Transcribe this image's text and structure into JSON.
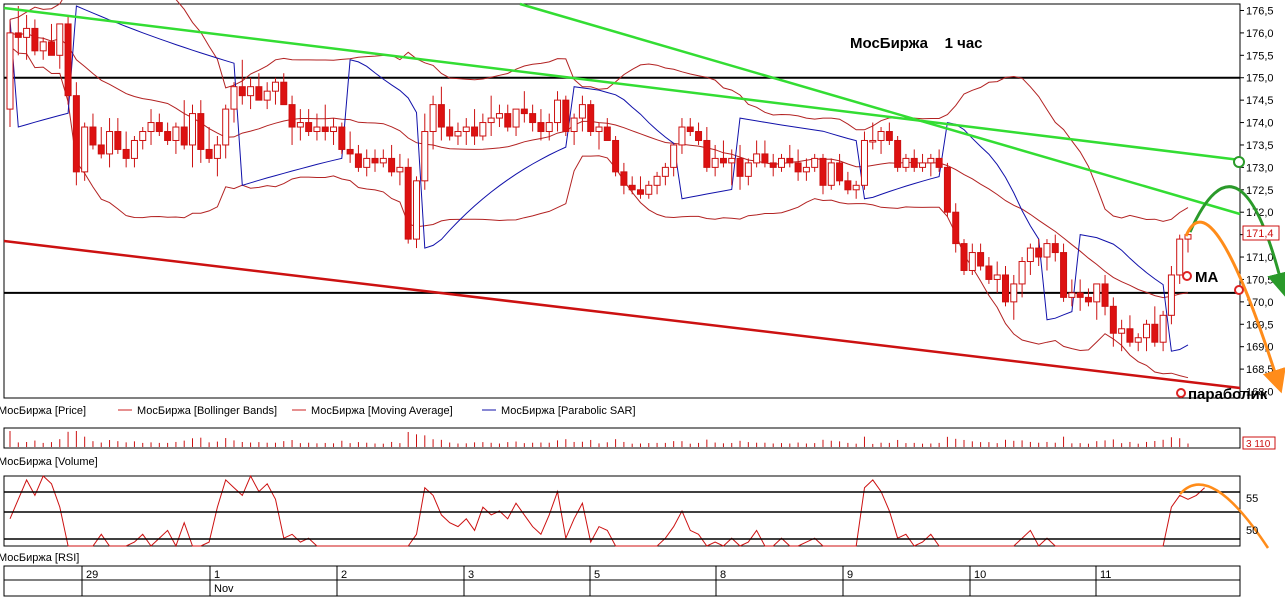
{
  "chart_data": {
    "type": "candlestick",
    "title": "МосБиржа    1 час",
    "price_axis": {
      "ylim": [
        167.9,
        176.6
      ],
      "ticks": [
        "176,5",
        "176,0",
        "175,5",
        "175,0",
        "174,5",
        "174,0",
        "173,5",
        "173,0",
        "172,5",
        "172,0",
        "171,5",
        "171,0",
        "170,5",
        "170,0",
        "169,5",
        "169,0",
        "168,5",
        "168,0"
      ]
    },
    "last_price_label": "171,4",
    "volume_label": "3 110",
    "rsi_axis": {
      "ticks": [
        "55",
        "50"
      ]
    },
    "legend_price": [
      "МосБиржа [Price]",
      "МосБиржа [Bollinger Bands]",
      "МосБиржа [Moving Average]",
      "МосБиржа [Parabolic SAR]"
    ],
    "legend_volume": "МосБиржа [Volume]",
    "legend_rsi": "МосБиржа [RSI]",
    "annotations": {
      "ma": "MA",
      "sar": "параболик"
    },
    "dates": [
      {
        "label": "29",
        "sub": ""
      },
      {
        "label": "1",
        "sub": "Nov"
      },
      {
        "label": "2",
        "sub": ""
      },
      {
        "label": "3",
        "sub": ""
      },
      {
        "label": "5",
        "sub": ""
      },
      {
        "label": "8",
        "sub": ""
      },
      {
        "label": "9",
        "sub": ""
      },
      {
        "label": "10",
        "sub": ""
      },
      {
        "label": "11",
        "sub": ""
      }
    ],
    "horizontal_levels": [
      175.0,
      170.2
    ],
    "candles": [
      [
        174.3,
        176.3,
        173.9,
        176.0
      ],
      [
        176.0,
        176.6,
        175.5,
        175.9
      ],
      [
        175.9,
        176.4,
        175.4,
        176.1
      ],
      [
        176.1,
        176.3,
        175.5,
        175.6
      ],
      [
        175.6,
        175.9,
        175.4,
        175.8
      ],
      [
        175.8,
        176.2,
        175.6,
        175.5
      ],
      [
        175.5,
        176.1,
        175.2,
        176.2
      ],
      [
        176.2,
        176.4,
        174.4,
        174.6
      ],
      [
        174.6,
        174.9,
        172.6,
        172.9
      ],
      [
        172.9,
        174.0,
        172.7,
        173.9
      ],
      [
        173.9,
        174.2,
        173.4,
        173.5
      ],
      [
        173.5,
        173.9,
        173.2,
        173.3
      ],
      [
        173.3,
        174.1,
        173.0,
        173.8
      ],
      [
        173.8,
        174.1,
        173.3,
        173.4
      ],
      [
        173.4,
        173.8,
        173.0,
        173.2
      ],
      [
        173.2,
        173.7,
        173.0,
        173.6
      ],
      [
        173.6,
        173.9,
        173.4,
        173.8
      ],
      [
        173.8,
        174.3,
        173.5,
        174.0
      ],
      [
        174.0,
        174.2,
        173.7,
        173.8
      ],
      [
        173.8,
        174.0,
        173.5,
        173.6
      ],
      [
        173.6,
        174.0,
        173.3,
        173.9
      ],
      [
        173.9,
        174.5,
        173.4,
        173.5
      ],
      [
        173.5,
        174.4,
        173.0,
        174.2
      ],
      [
        174.2,
        174.5,
        173.1,
        173.4
      ],
      [
        173.4,
        173.9,
        173.1,
        173.2
      ],
      [
        173.2,
        173.7,
        172.8,
        173.5
      ],
      [
        173.5,
        174.4,
        173.2,
        174.3
      ],
      [
        174.3,
        174.9,
        174.0,
        174.8
      ],
      [
        174.8,
        175.4,
        174.4,
        174.6
      ],
      [
        174.6,
        175.0,
        174.3,
        174.8
      ],
      [
        174.8,
        175.1,
        174.5,
        174.5
      ],
      [
        174.5,
        174.9,
        174.3,
        174.7
      ],
      [
        174.7,
        175.0,
        174.4,
        174.9
      ],
      [
        174.9,
        175.1,
        174.6,
        174.4
      ],
      [
        174.4,
        174.6,
        173.5,
        173.9
      ],
      [
        173.9,
        174.3,
        173.6,
        174.0
      ],
      [
        174.0,
        174.3,
        173.7,
        173.8
      ],
      [
        173.8,
        174.2,
        173.6,
        173.9
      ],
      [
        173.9,
        174.4,
        173.6,
        173.8
      ],
      [
        173.8,
        174.1,
        173.5,
        173.9
      ],
      [
        173.9,
        174.0,
        173.3,
        173.4
      ],
      [
        173.4,
        173.8,
        173.1,
        173.3
      ],
      [
        173.3,
        173.5,
        172.9,
        173.0
      ],
      [
        173.0,
        173.4,
        172.8,
        173.2
      ],
      [
        173.2,
        173.4,
        172.9,
        173.1
      ],
      [
        173.1,
        173.4,
        173.0,
        173.2
      ],
      [
        173.2,
        173.5,
        172.8,
        172.9
      ],
      [
        172.9,
        173.3,
        172.6,
        173.0
      ],
      [
        173.0,
        173.2,
        171.3,
        171.4
      ],
      [
        171.4,
        172.8,
        171.2,
        172.7
      ],
      [
        172.7,
        174.2,
        172.5,
        173.8
      ],
      [
        173.8,
        174.6,
        173.4,
        174.4
      ],
      [
        174.4,
        174.8,
        173.6,
        173.9
      ],
      [
        173.9,
        174.3,
        173.6,
        173.7
      ],
      [
        173.7,
        174.0,
        173.5,
        173.8
      ],
      [
        173.8,
        174.1,
        173.5,
        173.9
      ],
      [
        173.9,
        174.3,
        173.5,
        173.7
      ],
      [
        173.7,
        174.2,
        173.6,
        174.0
      ],
      [
        174.0,
        174.6,
        173.7,
        174.1
      ],
      [
        174.1,
        174.4,
        173.9,
        174.2
      ],
      [
        174.2,
        174.4,
        173.8,
        173.9
      ],
      [
        173.9,
        174.3,
        173.7,
        174.3
      ],
      [
        174.3,
        174.7,
        174.0,
        174.2
      ],
      [
        174.2,
        174.4,
        173.8,
        174.0
      ],
      [
        174.0,
        174.3,
        173.6,
        173.8
      ],
      [
        173.8,
        174.2,
        173.6,
        174.0
      ],
      [
        174.0,
        174.7,
        173.8,
        174.5
      ],
      [
        174.5,
        174.6,
        173.7,
        173.8
      ],
      [
        173.8,
        174.2,
        173.5,
        174.1
      ],
      [
        174.1,
        174.6,
        173.8,
        174.4
      ],
      [
        174.4,
        174.5,
        173.7,
        173.8
      ],
      [
        173.8,
        174.0,
        173.4,
        173.9
      ],
      [
        173.9,
        174.1,
        173.6,
        173.6
      ],
      [
        173.6,
        173.7,
        172.8,
        172.9
      ],
      [
        172.9,
        173.1,
        172.4,
        172.6
      ],
      [
        172.6,
        172.8,
        172.4,
        172.5
      ],
      [
        172.5,
        172.8,
        172.3,
        172.4
      ],
      [
        172.4,
        172.7,
        172.3,
        172.6
      ],
      [
        172.6,
        172.9,
        172.4,
        172.8
      ],
      [
        172.8,
        173.1,
        172.6,
        173.0
      ],
      [
        173.0,
        173.3,
        172.8,
        173.5
      ],
      [
        173.5,
        174.1,
        173.3,
        173.9
      ],
      [
        173.9,
        174.1,
        173.7,
        173.8
      ],
      [
        173.8,
        174.0,
        173.5,
        173.6
      ],
      [
        173.6,
        173.9,
        172.9,
        173.0
      ],
      [
        173.0,
        173.5,
        172.8,
        173.2
      ],
      [
        173.2,
        173.6,
        173.0,
        173.1
      ],
      [
        173.1,
        173.4,
        172.6,
        173.2
      ],
      [
        173.2,
        173.5,
        172.5,
        172.8
      ],
      [
        172.8,
        173.2,
        172.6,
        173.1
      ],
      [
        173.1,
        173.6,
        173.0,
        173.3
      ],
      [
        173.3,
        173.6,
        173.0,
        173.1
      ],
      [
        173.1,
        173.3,
        172.8,
        173.0
      ],
      [
        173.0,
        173.3,
        172.9,
        173.2
      ],
      [
        173.2,
        173.5,
        173.0,
        173.1
      ],
      [
        173.1,
        173.4,
        172.7,
        172.9
      ],
      [
        172.9,
        173.2,
        172.7,
        173.0
      ],
      [
        173.0,
        173.3,
        172.9,
        173.2
      ],
      [
        173.2,
        173.3,
        172.4,
        172.6
      ],
      [
        172.6,
        173.2,
        172.5,
        173.1
      ],
      [
        173.1,
        173.3,
        172.6,
        172.7
      ],
      [
        172.7,
        172.9,
        172.4,
        172.5
      ],
      [
        172.5,
        172.7,
        172.3,
        172.6
      ],
      [
        172.6,
        173.8,
        172.5,
        173.6
      ],
      [
        173.6,
        174.0,
        173.4,
        173.6
      ],
      [
        173.6,
        173.9,
        173.3,
        173.8
      ],
      [
        173.8,
        174.0,
        173.5,
        173.6
      ],
      [
        173.6,
        173.7,
        172.9,
        173.0
      ],
      [
        173.0,
        173.3,
        172.9,
        173.2
      ],
      [
        173.2,
        173.4,
        172.9,
        173.0
      ],
      [
        173.0,
        173.3,
        172.9,
        173.1
      ],
      [
        173.1,
        173.3,
        172.8,
        173.2
      ],
      [
        173.2,
        173.4,
        172.9,
        173.0
      ],
      [
        173.0,
        173.1,
        171.9,
        172.0
      ],
      [
        172.0,
        172.2,
        171.1,
        171.3
      ],
      [
        171.3,
        171.4,
        170.6,
        170.7
      ],
      [
        170.7,
        171.3,
        170.6,
        171.1
      ],
      [
        171.1,
        171.3,
        170.7,
        170.8
      ],
      [
        170.8,
        171.0,
        170.4,
        170.5
      ],
      [
        170.5,
        170.9,
        170.2,
        170.6
      ],
      [
        170.6,
        170.8,
        169.9,
        170.0
      ],
      [
        170.0,
        170.6,
        169.6,
        170.4
      ],
      [
        170.4,
        171.0,
        170.1,
        170.9
      ],
      [
        170.9,
        171.3,
        170.6,
        171.2
      ],
      [
        171.2,
        171.4,
        170.8,
        171.0
      ],
      [
        171.0,
        171.4,
        170.7,
        171.3
      ],
      [
        171.3,
        171.5,
        170.9,
        171.1
      ],
      [
        171.1,
        171.3,
        170.0,
        170.1
      ],
      [
        170.1,
        170.5,
        169.9,
        170.2
      ],
      [
        170.2,
        170.5,
        169.8,
        170.1
      ],
      [
        170.1,
        170.3,
        169.9,
        170.0
      ],
      [
        170.0,
        170.4,
        169.6,
        170.4
      ],
      [
        170.4,
        170.6,
        169.7,
        169.9
      ],
      [
        169.9,
        170.1,
        169.0,
        169.3
      ],
      [
        169.3,
        169.6,
        168.9,
        169.4
      ],
      [
        169.4,
        169.7,
        169.0,
        169.1
      ],
      [
        169.1,
        169.3,
        168.9,
        169.2
      ],
      [
        169.2,
        169.6,
        168.9,
        169.5
      ],
      [
        169.5,
        169.9,
        169.0,
        169.1
      ],
      [
        169.1,
        169.8,
        168.9,
        169.7
      ],
      [
        169.7,
        170.8,
        169.5,
        170.6
      ],
      [
        170.6,
        171.5,
        170.4,
        171.4
      ],
      [
        171.4,
        171.6,
        171.1,
        171.5
      ]
    ],
    "rsi_values": [
      52,
      57,
      62,
      58,
      64,
      61,
      55,
      43,
      35,
      32,
      40,
      48,
      45,
      42,
      44,
      46,
      48,
      45,
      47,
      49,
      43,
      51,
      45,
      42,
      46,
      55,
      62,
      60,
      58,
      63,
      59,
      61,
      57,
      47,
      48,
      46,
      47,
      44,
      45,
      42,
      41,
      43,
      40,
      41,
      42,
      44,
      41,
      43,
      31,
      48,
      60,
      58,
      53,
      51,
      50,
      52,
      49,
      55,
      53,
      54,
      52,
      56,
      53,
      50,
      48,
      53,
      59,
      47,
      52,
      56,
      46,
      50,
      49,
      38,
      35,
      38,
      40,
      43,
      45,
      47,
      50,
      54,
      49,
      48,
      42,
      46,
      45,
      47,
      43,
      46,
      49,
      44,
      45,
      47,
      44,
      43,
      46,
      47,
      40,
      45,
      44,
      42,
      43,
      60,
      62,
      59,
      54,
      47,
      48,
      45,
      46,
      48,
      45,
      30,
      32,
      29,
      42,
      40,
      38,
      41,
      36,
      42,
      47,
      49,
      45,
      47,
      44,
      36,
      39,
      37,
      38,
      42,
      37,
      32,
      38,
      36,
      37,
      42,
      36,
      45,
      55,
      58,
      57,
      58,
      60
    ]
  }
}
